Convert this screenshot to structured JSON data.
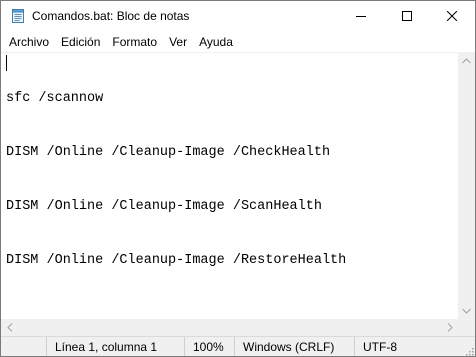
{
  "window": {
    "title": "Comandos.bat: Bloc de notas"
  },
  "menu": {
    "items": [
      "Archivo",
      "Edición",
      "Formato",
      "Ver",
      "Ayuda"
    ]
  },
  "editor": {
    "lines": [
      "sfc /scannow",
      "DISM /Online /Cleanup-Image /CheckHealth",
      "DISM /Online /Cleanup-Image /ScanHealth",
      "DISM /Online /Cleanup-Image /RestoreHealth"
    ]
  },
  "status": {
    "position": "Línea 1, columna 1",
    "zoom": "100%",
    "line_ending": "Windows (CRLF)",
    "encoding": "UTF-8"
  },
  "icons": {
    "app": "notepad-icon",
    "minimize": "minimize-icon",
    "maximize": "maximize-icon",
    "close": "close-icon"
  }
}
